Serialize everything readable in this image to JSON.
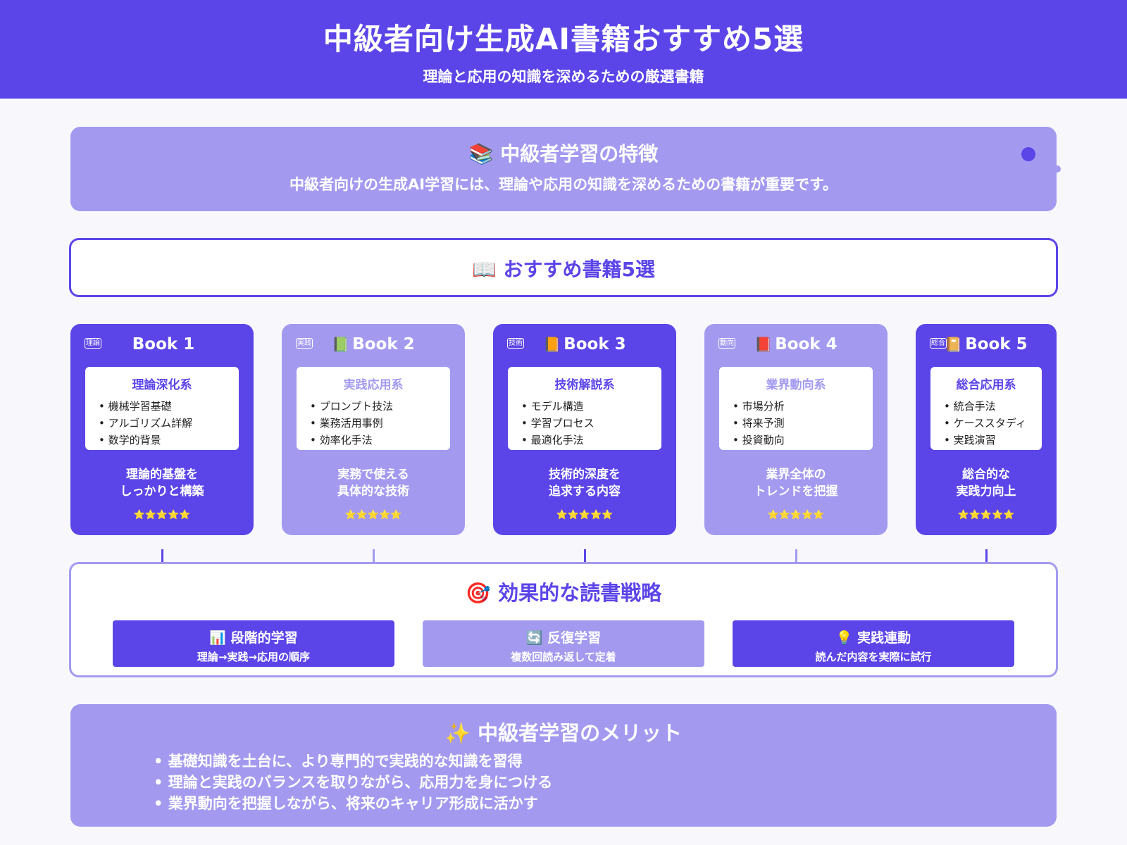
{
  "header": {
    "title": "中級者向け生成AI書籍おすすめ5選",
    "subtitle": "理論と応用の知識を深めるための厳選書籍"
  },
  "features": {
    "icon": "books-icon",
    "title": "📚 中級者学習の特徴",
    "text": "中級者向けの生成AI学習には、理論や応用の知識を深めるための書籍が重要です。"
  },
  "recommend": {
    "title": "📖 おすすめ書籍5選"
  },
  "books": [
    {
      "tag": "理論",
      "emoji": "",
      "title": "Book 1",
      "category": "理論深化系",
      "items": [
        "機械学習基礎",
        "アルゴリズム詳解",
        "数学的背景"
      ],
      "desc": "理論的基盤を\nしっかりと構築",
      "stars": "⭐⭐⭐⭐⭐",
      "theme": "dark"
    },
    {
      "tag": "実践",
      "emoji": "📗",
      "title": "Book 2",
      "category": "実践応用系",
      "items": [
        "プロンプト技法",
        "業務活用事例",
        "効率化手法"
      ],
      "desc": "実務で使える\n具体的な技術",
      "stars": "⭐⭐⭐⭐⭐",
      "theme": "light"
    },
    {
      "tag": "技術",
      "emoji": "📙",
      "title": "Book 3",
      "category": "技術解説系",
      "items": [
        "モデル構造",
        "学習プロセス",
        "最適化手法"
      ],
      "desc": "技術的深度を\n追求する内容",
      "stars": "⭐⭐⭐⭐⭐",
      "theme": "dark"
    },
    {
      "tag": "動向",
      "emoji": "📕",
      "title": "Book 4",
      "category": "業界動向系",
      "items": [
        "市場分析",
        "将来予測",
        "投資動向"
      ],
      "desc": "業界全体の\nトレンドを把握",
      "stars": "⭐⭐⭐⭐⭐",
      "theme": "light"
    },
    {
      "tag": "総合",
      "emoji": "📔",
      "title": "Book 5",
      "category": "総合応用系",
      "items": [
        "統合手法",
        "ケーススタディ",
        "実践演習"
      ],
      "desc": "総合的な\n実践力向上",
      "stars": "⭐⭐⭐⭐⭐",
      "theme": "dark"
    }
  ],
  "strategy": {
    "title": "🎯 効果的な読書戦略",
    "items": [
      {
        "title": "📊 段階的学習",
        "text": "理論→実践→応用の順序"
      },
      {
        "title": "🔄 反復学習",
        "text": "複数回読み返して定着"
      },
      {
        "title": "💡 実践連動",
        "text": "読んだ内容を実際に試行"
      }
    ]
  },
  "merits": {
    "title": "✨ 中級者学習のメリット",
    "items": [
      "基礎知識を土台に、より専門的で実践的な知識を習得",
      "理論と実践のバランスを取りながら、応用力を身につける",
      "業界動向を把握しながら、将来のキャリア形成に活かす"
    ]
  },
  "colors": {
    "primary": "#5b45e8",
    "light": "#a39af0",
    "star": "#ffd23f"
  }
}
